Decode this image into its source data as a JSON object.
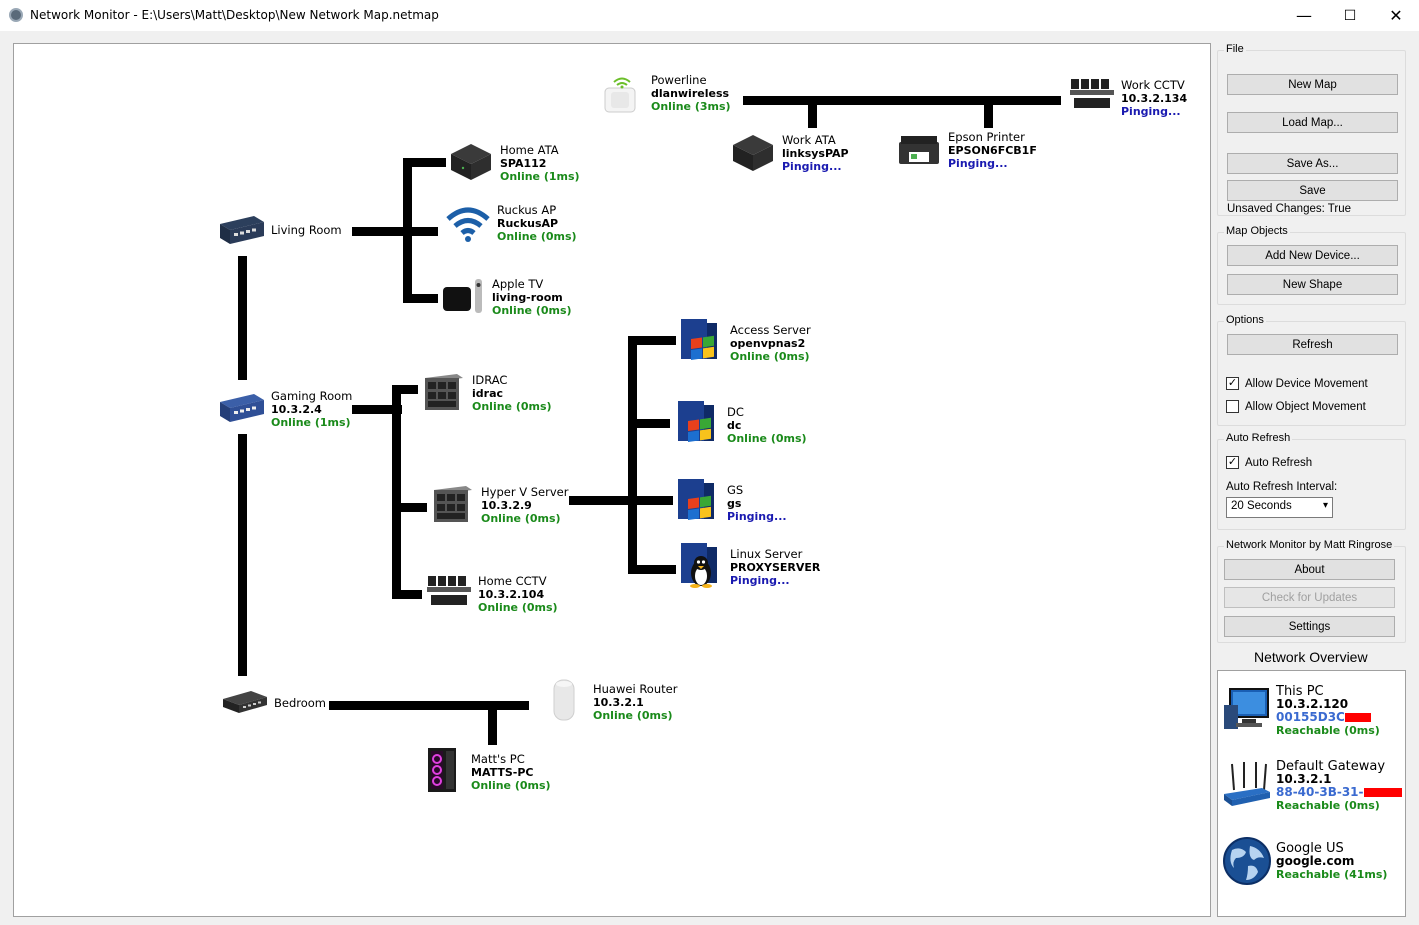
{
  "window": {
    "title": "Network Monitor - E:\\Users\\Matt\\Desktop\\New Network Map.netmap",
    "min": "—",
    "max": "☐",
    "close": "✕"
  },
  "devices": {
    "powerline": {
      "name": "Powerline",
      "host": "dlanwireless",
      "status": "Online (3ms)"
    },
    "work_cctv": {
      "name": "Work CCTV",
      "host": "10.3.2.134",
      "status": "Pinging..."
    },
    "work_ata": {
      "name": "Work ATA",
      "host": "linksysPAP",
      "status": "Pinging..."
    },
    "epson": {
      "name": "Epson Printer",
      "host": "EPSON6FCB1F",
      "status": "Pinging..."
    },
    "home_ata": {
      "name": "Home ATA",
      "host": "SPA112",
      "status": "Online (1ms)"
    },
    "ruckus": {
      "name": "Ruckus AP",
      "host": "RuckusAP",
      "status": "Online (0ms)"
    },
    "appletv": {
      "name": "Apple TV",
      "host": "living-room",
      "status": "Online (0ms)"
    },
    "living_room": {
      "name": "Living Room"
    },
    "gaming_room": {
      "name": "Gaming Room",
      "host": "10.3.2.4",
      "status": "Online (1ms)"
    },
    "idrac": {
      "name": "IDRAC",
      "host": "idrac",
      "status": "Online (0ms)"
    },
    "hyperv": {
      "name": "Hyper V Server",
      "host": "10.3.2.9",
      "status": "Online (0ms)"
    },
    "home_cctv": {
      "name": "Home CCTV",
      "host": "10.3.2.104",
      "status": "Online (0ms)"
    },
    "access": {
      "name": "Access Server",
      "host": "openvpnas2",
      "status": "Online (0ms)"
    },
    "dc": {
      "name": "DC",
      "host": "dc",
      "status": "Online (0ms)"
    },
    "gs": {
      "name": "GS",
      "host": "gs",
      "status": "Pinging..."
    },
    "linux": {
      "name": "Linux Server",
      "host": "PROXYSERVER",
      "status": "Pinging..."
    },
    "bedroom": {
      "name": "Bedroom"
    },
    "huawei": {
      "name": "Huawei Router",
      "host": "10.3.2.1",
      "status": "Online (0ms)"
    },
    "mattspc": {
      "name": "Matt's PC",
      "host": "MATTS-PC",
      "status": "Online (0ms)"
    }
  },
  "panel": {
    "file_label": "File",
    "new_map": "New Map",
    "load_map": "Load Map...",
    "save_as": "Save As...",
    "save": "Save",
    "unsaved": "Unsaved Changes: True",
    "map_objects_label": "Map Objects",
    "add_device": "Add New Device...",
    "new_shape": "New Shape",
    "options_label": "Options",
    "refresh": "Refresh",
    "allow_device_movement": "Allow Device Movement",
    "allow_device_movement_checked": true,
    "allow_object_movement": "Allow Object Movement",
    "allow_object_movement_checked": false,
    "auto_refresh_label": "Auto Refresh",
    "auto_refresh": "Auto Refresh",
    "auto_refresh_checked": true,
    "interval_label": "Auto Refresh Interval:",
    "interval_value": "20 Seconds",
    "about_group_label": "Network Monitor by Matt Ringrose",
    "about": "About",
    "check_updates": "Check for Updates",
    "settings": "Settings"
  },
  "overview": {
    "title": "Network Overview",
    "this_pc": {
      "name": "This PC",
      "ip": "10.3.2.120",
      "mac": "00155D3C",
      "status": "Reachable (0ms)"
    },
    "gateway": {
      "name": "Default Gateway",
      "ip": "10.3.2.1",
      "mac": "88-40-3B-31-",
      "status": "Reachable (0ms)"
    },
    "google": {
      "name": "Google US",
      "host": "google.com",
      "status": "Reachable (41ms)"
    }
  },
  "colors": {
    "online": "#1a8a1a",
    "pinging": "#1a1ab0",
    "mac": "#3a6ad0",
    "redaction": "#ff0000"
  }
}
